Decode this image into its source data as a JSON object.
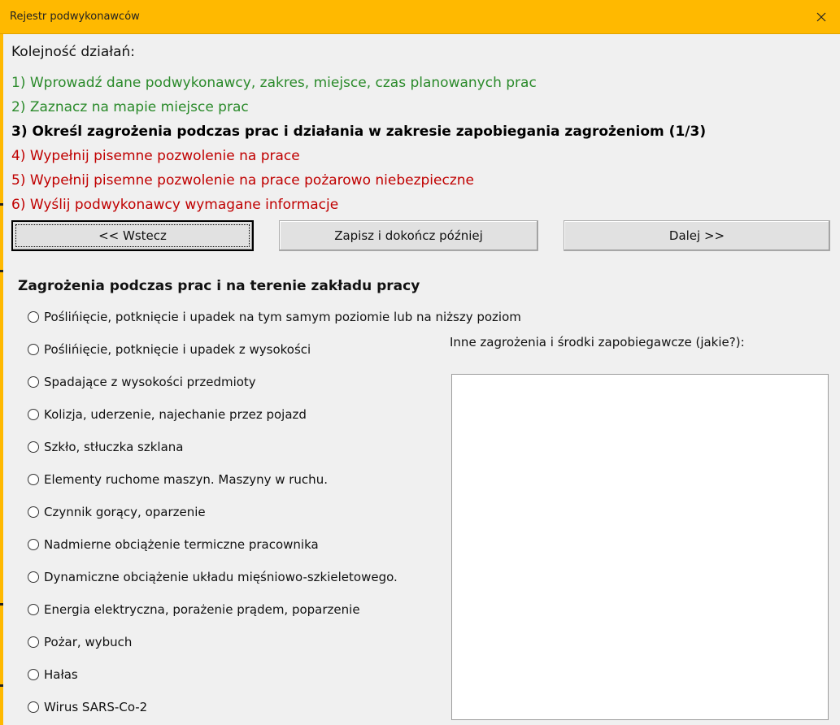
{
  "window": {
    "title": "Rejestr podwykonawców",
    "close_icon": "close-icon"
  },
  "order": {
    "title": "Kolejność działań:",
    "steps": [
      {
        "label": "1) Wprowadź dane podwykonawcy, zakres, miejsce, czas planowanych prac",
        "status": "done",
        "color": "#2a8a2a"
      },
      {
        "label": "2) Zaznacz na mapie miejsce prac",
        "status": "done",
        "color": "#2a8a2a"
      },
      {
        "label": "3) Określ zagrożenia podczas prac i działania w zakresie zapobiegania zagrożeniom (1/3)",
        "status": "current",
        "color": "#000000"
      },
      {
        "label": "4) Wypełnij pisemne pozwolenie na prace",
        "status": "todo",
        "color": "#c00000"
      },
      {
        "label": "5) Wypełnij pisemne pozwolenie na prace pożarowo niebezpieczne",
        "status": "todo",
        "color": "#c00000"
      },
      {
        "label": "6) Wyślij podwykonawcy wymagane informacje",
        "status": "todo",
        "color": "#c00000"
      }
    ]
  },
  "buttons": {
    "back": "<< Wstecz",
    "save_later": "Zapisz i dokończ później",
    "next": "Dalej >>"
  },
  "hazards": {
    "title": "Zagrożenia podczas prac i na terenie zakładu pracy",
    "options": [
      {
        "label": "Poślińięcie, potknięcie i upadek na tym samym poziomie lub na niższy poziom",
        "checked": false
      },
      {
        "label": "Poślińięcie, potknięcie i upadek z wysokości",
        "checked": false
      },
      {
        "label": "Spadające z wysokości przedmioty",
        "checked": false
      },
      {
        "label": "Kolizja, uderzenie, najechanie przez pojazd",
        "checked": false
      },
      {
        "label": "Szkło, stłuczka szklana",
        "checked": false
      },
      {
        "label": "Elementy ruchome maszyn. Maszyny w ruchu.",
        "checked": false
      },
      {
        "label": "Czynnik gorący, oparzenie",
        "checked": false
      },
      {
        "label": "Nadmierne obciążenie termiczne pracownika",
        "checked": false
      },
      {
        "label": "Dynamiczne obciążenie układu mięśniowo-szkieletowego.",
        "checked": false
      },
      {
        "label": "Energia elektryczna, porażenie prądem, poparzenie",
        "checked": false
      },
      {
        "label": "Pożar, wybuch",
        "checked": false
      },
      {
        "label": "Hałas",
        "checked": false
      },
      {
        "label": "Wirus SARS-Co-2",
        "checked": false
      }
    ]
  },
  "other": {
    "label": "Inne zagrożenia i środki zapobiegawcze (jakie?):",
    "value": ""
  },
  "colors": {
    "titlebar": "#ffb900",
    "done": "#2a8a2a",
    "todo": "#c00000"
  }
}
